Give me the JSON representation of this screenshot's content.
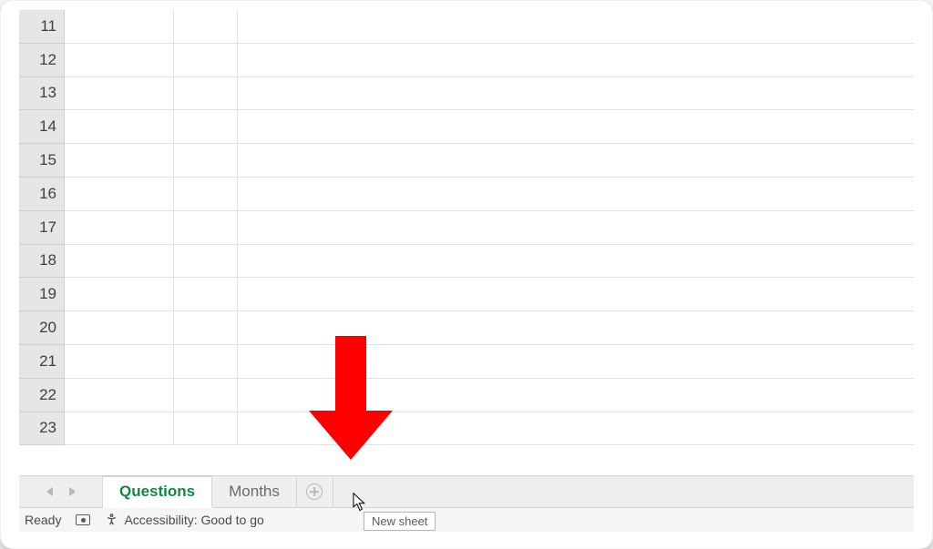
{
  "rows": [
    "11",
    "12",
    "13",
    "14",
    "15",
    "16",
    "17",
    "18",
    "19",
    "20",
    "21",
    "22",
    "23"
  ],
  "tabs": {
    "active_label": "Questions",
    "other_label": "Months"
  },
  "tooltip_text": "New sheet",
  "status": {
    "ready": "Ready",
    "accessibility": "Accessibility: Good to go"
  },
  "annotation": {
    "color": "#ff0000"
  }
}
